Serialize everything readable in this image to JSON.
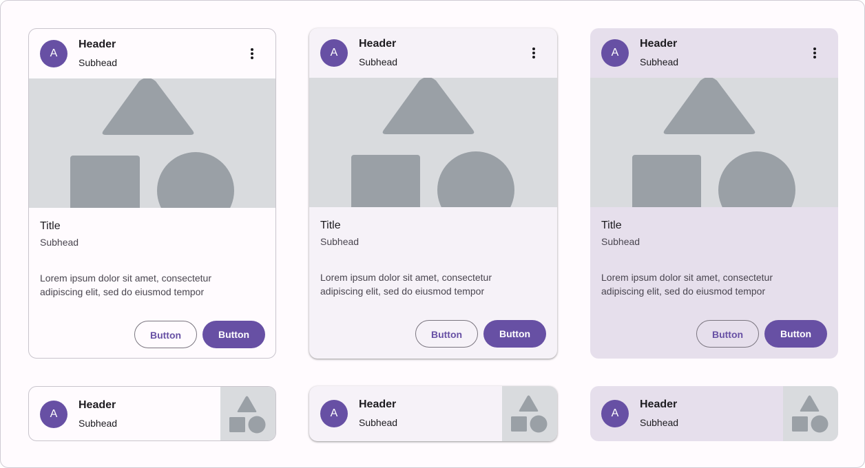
{
  "colors": {
    "primary": "#6750a4",
    "media_bg": "#d9dbde",
    "shape": "#9aa0a6",
    "outlined_bg": "#fffbfe",
    "elevated_bg": "#f6f2f8",
    "filled_bg": "#e6dfec"
  },
  "cards": [
    {
      "variant": "outlined",
      "avatar": "A",
      "header": "Header",
      "subhead": "Subhead",
      "menu_icon": "more-vert-icon",
      "title": "Title",
      "title_subhead": "Subhead",
      "body": "Lorem ipsum dolor sit amet, consectetur adipiscing elit, sed do eiusmod tempor",
      "secondary_button": "Button",
      "primary_button": "Button"
    },
    {
      "variant": "elevated",
      "avatar": "A",
      "header": "Header",
      "subhead": "Subhead",
      "menu_icon": "more-vert-icon",
      "title": "Title",
      "title_subhead": "Subhead",
      "body": "Lorem ipsum dolor sit amet, consectetur adipiscing elit, sed do eiusmod tempor",
      "secondary_button": "Button",
      "primary_button": "Button"
    },
    {
      "variant": "filled",
      "avatar": "A",
      "header": "Header",
      "subhead": "Subhead",
      "menu_icon": "more-vert-icon",
      "title": "Title",
      "title_subhead": "Subhead",
      "body": "Lorem ipsum dolor sit amet, consectetur adipiscing elit, sed do eiusmod tempor",
      "secondary_button": "Button",
      "primary_button": "Button"
    }
  ],
  "compact_cards": [
    {
      "variant": "outlined",
      "avatar": "A",
      "header": "Header",
      "subhead": "Subhead"
    },
    {
      "variant": "elevated",
      "avatar": "A",
      "header": "Header",
      "subhead": "Subhead"
    },
    {
      "variant": "filled",
      "avatar": "A",
      "header": "Header",
      "subhead": "Subhead"
    }
  ]
}
